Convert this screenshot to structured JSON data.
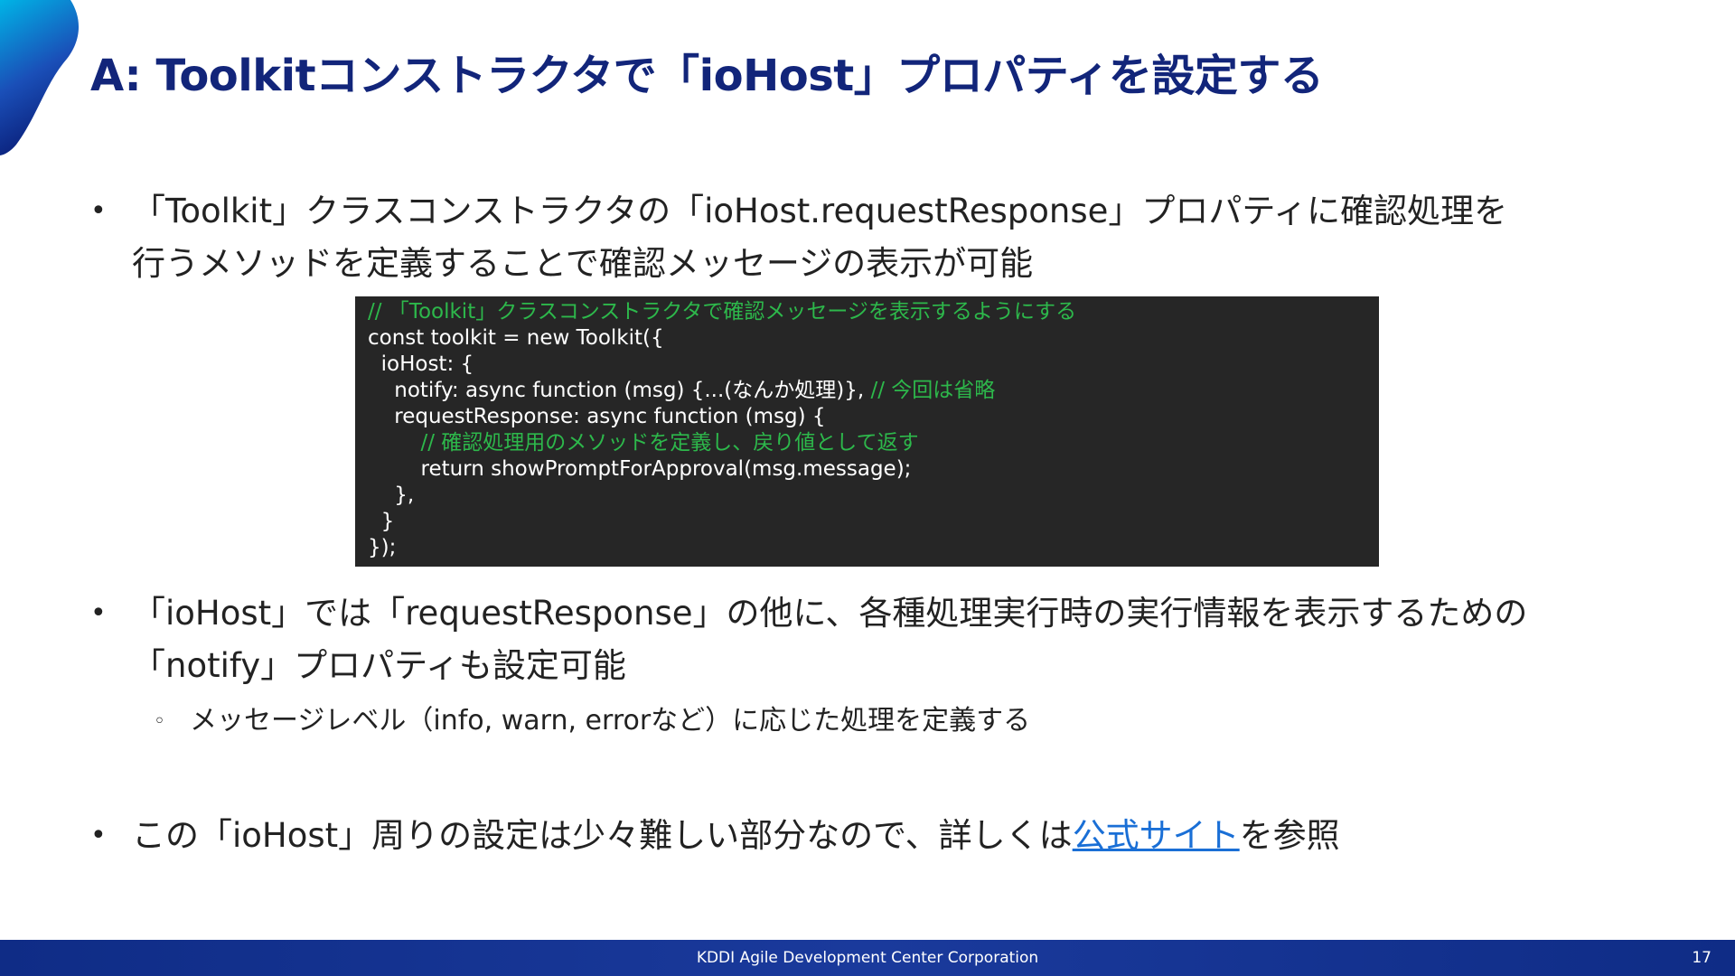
{
  "slide": {
    "title": "A: Toolkitコンストラクタで「ioHost」プロパティを設定する"
  },
  "bullets": [
    {
      "marker": "•",
      "lines": [
        "「Toolkit」クラスコンストラクタの「ioHost.requestResponse」プロパティに確認処理を",
        "行うメソッドを定義することで確認メッセージの表示が可能"
      ]
    },
    {
      "marker": "•",
      "lines": [
        "「ioHost」では「requestResponse」の他に、各種処理実行時の実行情報を表示するための",
        "「notify」プロパティも設定可能"
      ],
      "sub_bullet": {
        "marker": "◦",
        "text": "メッセージレベル（info, warn, errorなど）に応じた処理を定義する"
      }
    },
    {
      "marker": "•",
      "text_before": "この「ioHost」周りの設定は少々難しい部分なので、詳しくは",
      "link_text": "公式サイト",
      "text_after": "を参照"
    }
  ],
  "code": {
    "line1_comment": "// 「Toolkit」クラスコンストラクタで確認メッセージを表示するようにする",
    "line2": "const toolkit = new Toolkit({",
    "line3": "  ioHost: {",
    "line4_code": "    notify: async function (msg) {...(なんか処理)}, ",
    "line4_comment": "// 今回は省略",
    "line5": "    requestResponse: async function (msg) {",
    "line6_comment": "        // 確認処理用のメソッドを定義し、戻り値として返す",
    "line7": "        return showPromptForApproval(msg.message);",
    "line8": "    },",
    "line9": "  }",
    "line10": "});"
  },
  "footer": {
    "company": "KDDI Agile Development Center Corporation",
    "page_number": "17"
  },
  "colors": {
    "title": "#12257a",
    "code_background": "#262626",
    "code_comment": "#2db84b",
    "link": "#1a6fd6",
    "footer_background": "#0f2c86",
    "corner_gradient_start": "#00b4e6",
    "corner_gradient_end": "#0a1e78"
  }
}
